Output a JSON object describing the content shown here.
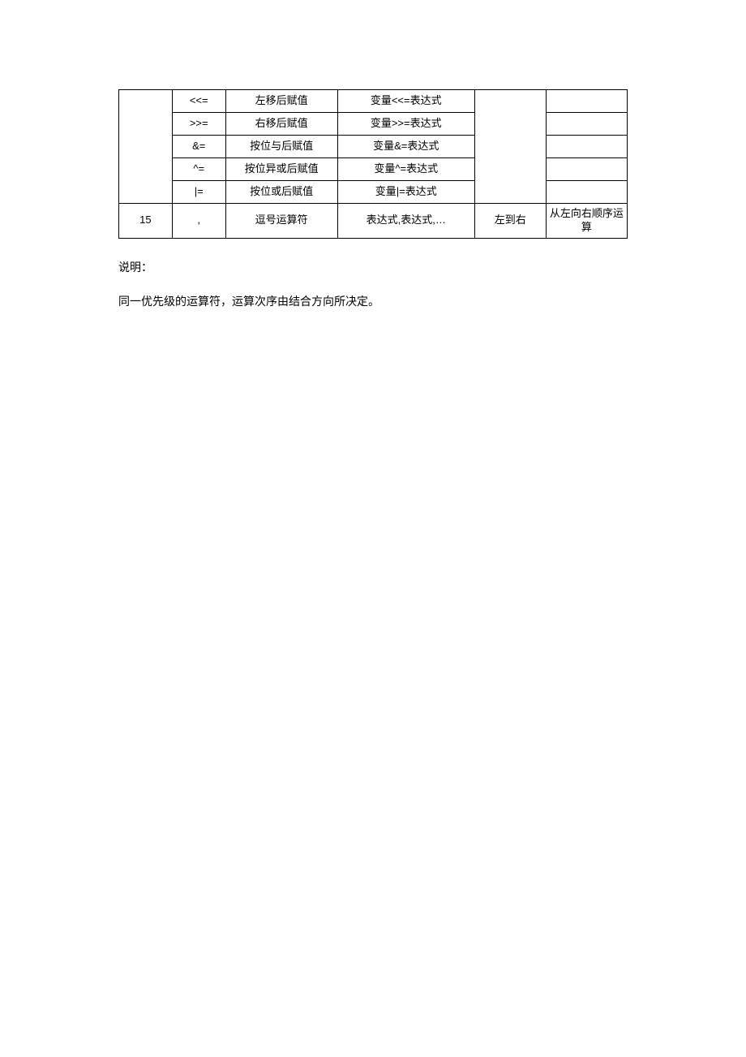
{
  "table": {
    "rows": [
      {
        "op": "<<=",
        "desc": "左移后赋值",
        "usage": "变量<<=表达式",
        "note": ""
      },
      {
        "op": ">>=",
        "desc": "右移后赋值",
        "usage": "变量>>=表达式",
        "note": ""
      },
      {
        "op": "&=",
        "desc": "按位与后赋值",
        "usage": "变量&=表达式",
        "note": ""
      },
      {
        "op": "^=",
        "desc": "按位异或后赋值",
        "usage": "变量^=表达式",
        "note": ""
      },
      {
        "op": "|=",
        "desc": "按位或后赋值",
        "usage": "变量|=表达式",
        "note": ""
      }
    ],
    "lastRow": {
      "priority": "15",
      "op": ",",
      "desc": "逗号运算符",
      "usage": "表达式,表达式,…",
      "assoc": "左到右",
      "note": "从左向右顺序运算"
    }
  },
  "notes": {
    "line1": "说明：",
    "line2": "同一优先级的运算符，运算次序由结合方向所决定。"
  }
}
